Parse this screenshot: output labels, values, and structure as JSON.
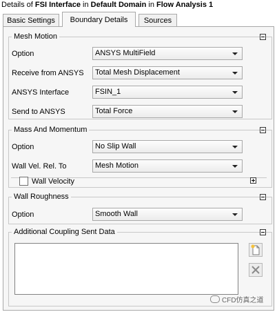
{
  "title": {
    "prefix": "Details of ",
    "object": "FSI Interface",
    "in1": " in ",
    "domain": "Default Domain",
    "in2": " in ",
    "analysis": "Flow Analysis 1"
  },
  "tabs": [
    {
      "label": "Basic Settings",
      "active": false
    },
    {
      "label": "Boundary Details",
      "active": true
    },
    {
      "label": "Sources",
      "active": false
    }
  ],
  "mesh_motion": {
    "title": "Mesh Motion",
    "rows": [
      {
        "label": "Option",
        "value": "ANSYS MultiField"
      },
      {
        "label": "Receive from ANSYS",
        "value": "Total Mesh Displacement"
      },
      {
        "label": "ANSYS Interface",
        "value": "FSIN_1"
      },
      {
        "label": "Send to ANSYS",
        "value": "Total Force"
      }
    ]
  },
  "mass_momentum": {
    "title": "Mass And Momentum",
    "rows": [
      {
        "label": "Option",
        "value": "No Slip Wall"
      },
      {
        "label": "Wall Vel. Rel. To",
        "value": "Mesh Motion"
      }
    ],
    "wall_velocity": {
      "label": "Wall Velocity",
      "checked": false
    }
  },
  "wall_roughness": {
    "title": "Wall Roughness",
    "rows": [
      {
        "label": "Option",
        "value": "Smooth Wall"
      }
    ]
  },
  "coupling": {
    "title": "Additional Coupling Sent Data",
    "items": []
  },
  "watermark": "CFD仿真之道",
  "icons": {
    "collapse": "collapse-icon",
    "expand": "expand-icon",
    "new": "new-item-icon",
    "delete": "delete-icon",
    "dropdown": "chevron-down-icon"
  }
}
